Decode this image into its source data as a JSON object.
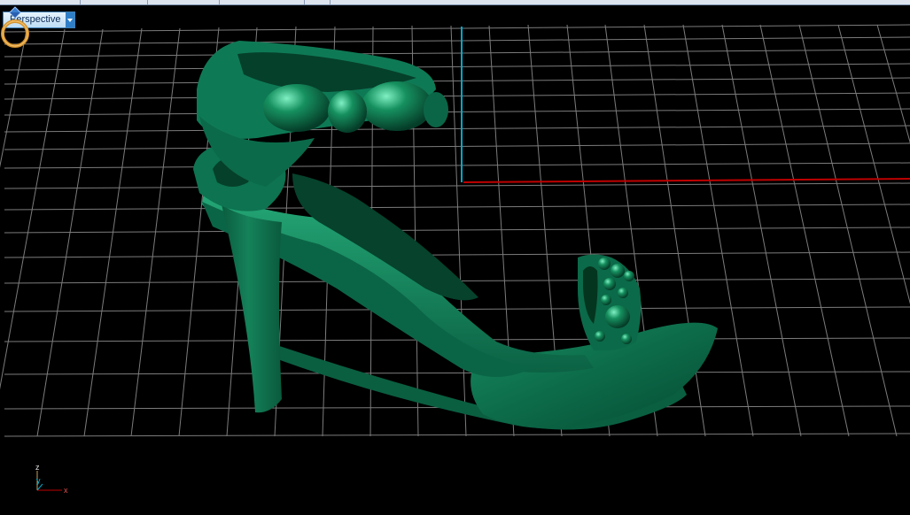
{
  "viewport": {
    "label": "Perspective",
    "dropdown_icon": "chevron-down-icon",
    "corner_icon": "ring-icon",
    "model_color": "#0f7a55",
    "grid_color": "#7c7c7c",
    "x_axis_color": "#c00000",
    "y_axis_color": "#00a8c8"
  },
  "axis_indicator": {
    "z_label": "z",
    "y_label": "y",
    "x_label": "x"
  }
}
